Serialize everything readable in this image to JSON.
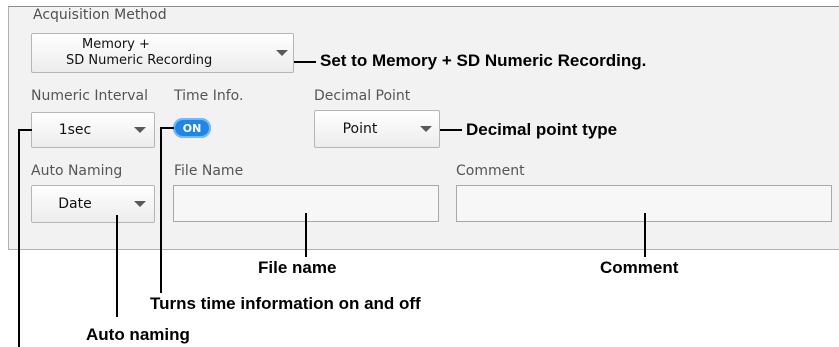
{
  "panel": {
    "title": "Acquisition Method"
  },
  "acquisition_method": {
    "line1": "Memory +",
    "line2": "SD Numeric Recording"
  },
  "numeric_interval": {
    "label": "Numeric Interval",
    "value": "1sec"
  },
  "time_info": {
    "label": "Time Info.",
    "state": "ON"
  },
  "decimal_point": {
    "label": "Decimal Point",
    "value": "Point"
  },
  "auto_naming": {
    "label": "Auto Naming",
    "value": "Date"
  },
  "file_name": {
    "label": "File Name",
    "value": ""
  },
  "comment": {
    "label": "Comment",
    "value": ""
  },
  "annotations": {
    "acquisition": "Set to Memory + SD Numeric Recording.",
    "decimal": "Decimal point type",
    "file_name": "File name",
    "comment": "Comment",
    "time_info": "Turns time information on and off",
    "auto_naming": "Auto naming"
  },
  "colors": {
    "toggle_on": "#1e86e6",
    "panel_bg": "#f2f2f2"
  }
}
